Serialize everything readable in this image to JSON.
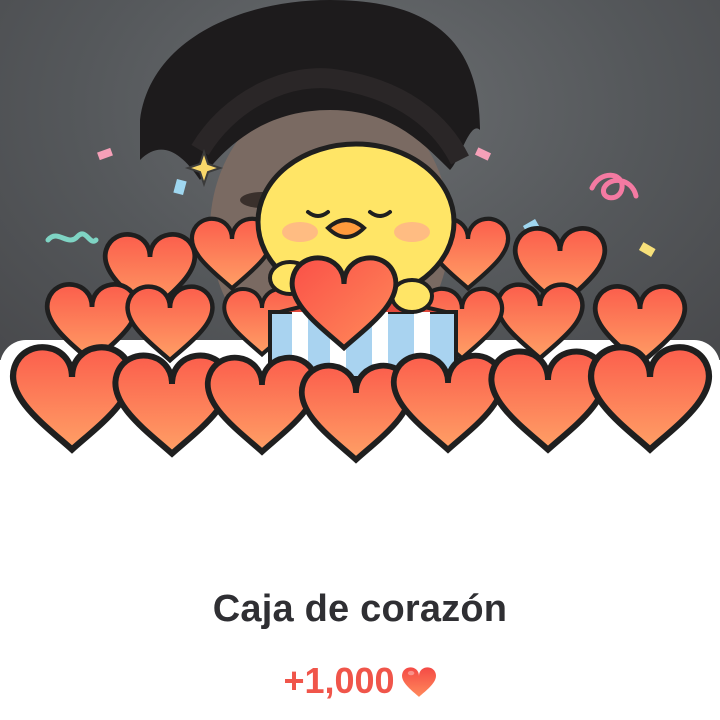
{
  "reward_popup": {
    "title": "Caja de corazón",
    "amount": "+1,000",
    "amount_icon": "heart-icon",
    "illustration": "yellow-chick-with-hearts",
    "colors": {
      "accent": "#f0554a",
      "heart_top": "#fb6b4f",
      "heart_bottom": "#ff9a63",
      "chick": "#ffe566",
      "title_text": "#2f2f33"
    }
  }
}
